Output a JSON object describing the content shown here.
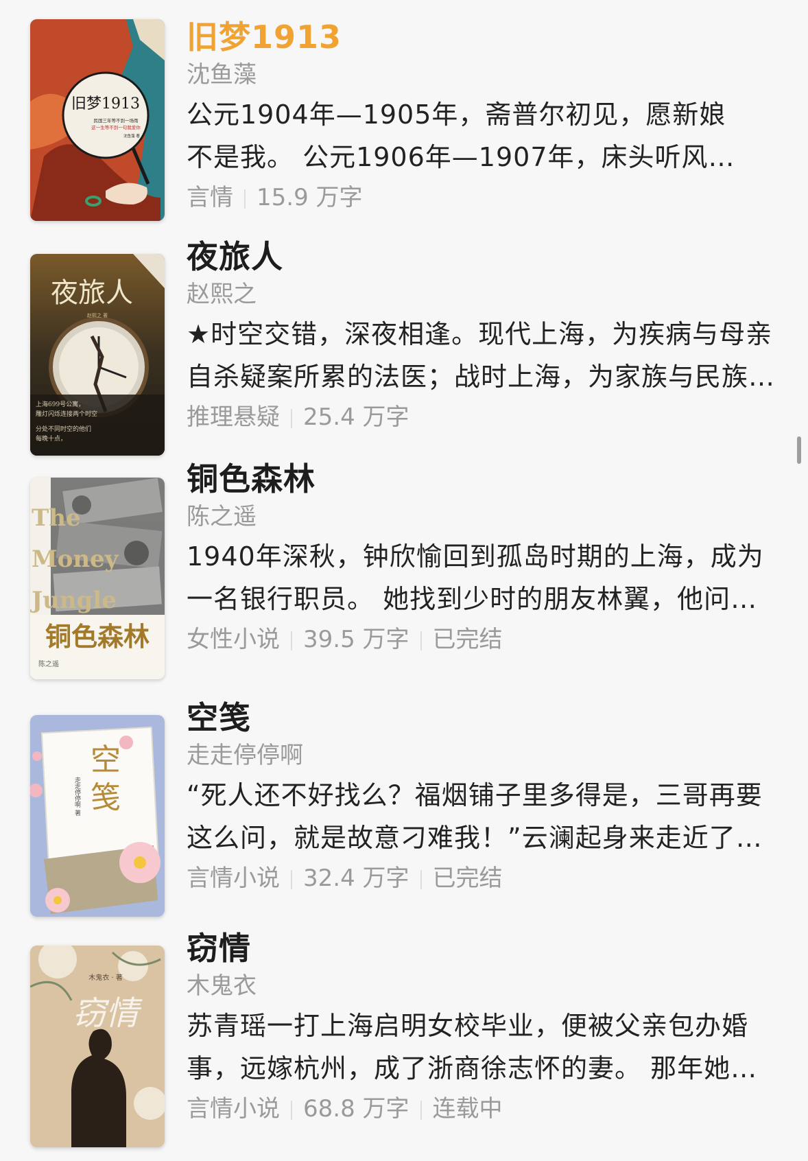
{
  "books": [
    {
      "title": "旧梦1913",
      "author": "沈鱼藻",
      "desc_line1": "公元1904年—1905年，斋普尔初见，愿新娘",
      "desc_line2": "不是我。 公元1906年—1907年，床头听风…",
      "genre": "言情",
      "words": "15.9 万字",
      "status": "",
      "cover_title": "旧梦1913",
      "cover_sub1": "民国三年等不到一场雨",
      "cover_sub2": "这一生等不到一句我爱你",
      "cover_author": "沈鱼藻 著"
    },
    {
      "title": "夜旅人",
      "author": "赵熙之",
      "desc_line1": "★时空交错，深夜相逢。现代上海，为疾病与母亲",
      "desc_line2": "自杀疑案所累的法医；战时上海，为家族与民族…",
      "genre": "推理悬疑",
      "words": "25.4 万字",
      "status": "",
      "cover_title": "夜旅人",
      "cover_author": "赵熙之 著",
      "cover_sub1": "上海699号公寓，",
      "cover_sub2": "雕灯闪烁连接两个时空",
      "cover_sub3": "分处不同时空的他们",
      "cover_sub4": "每晚十点，"
    },
    {
      "title": "铜色森林",
      "author": "陈之遥",
      "desc_line1": "1940年深秋，钟欣愉回到孤岛时期的上海，成为",
      "desc_line2": "一名银行职员。 她找到少时的朋友林翼，他问…",
      "genre": "女性小说",
      "words": "39.5 万字",
      "status": "已完结",
      "cover_title": "铜色森林",
      "cover_en1": "The",
      "cover_en2": "Money",
      "cover_en3": "Jungle",
      "cover_author": "陈之遥"
    },
    {
      "title": "空笺",
      "author": "走走停停啊",
      "desc_line1": "“死人还不好找么？福烟铺子里多得是，三哥再要",
      "desc_line2": "这么问，就是故意刁难我！”云澜起身来走近了…",
      "genre": "言情小说",
      "words": "32.4 万字",
      "status": "已完结",
      "cover_title1": "空",
      "cover_title2": "笺",
      "cover_author": "走走停停啊 著"
    },
    {
      "title": "窃情",
      "author": "木鬼衣",
      "desc_line1": "苏青瑶一打上海启明女校毕业，便被父亲包办婚",
      "desc_line2": "事，远嫁杭州，成了浙商徐志怀的妻。 那年她…",
      "genre": "言情小说",
      "words": "68.8 万字",
      "status": "连载中",
      "cover_title": "窃情",
      "cover_author": "木鬼衣 · 著"
    }
  ],
  "colors": {
    "accent": "#f0a232",
    "meta": "#9a9a9a",
    "bg": "#f7f7f7"
  }
}
